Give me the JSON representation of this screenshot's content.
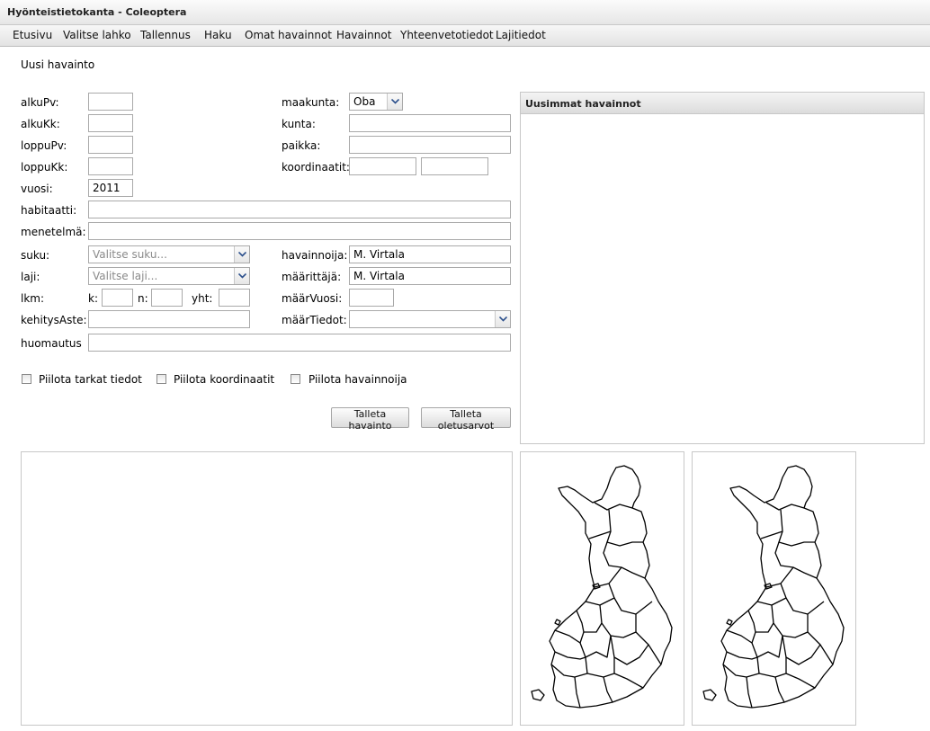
{
  "window": {
    "title": "Hyönteistietokanta - Coleoptera"
  },
  "menu": [
    {
      "label": "Etusivu"
    },
    {
      "label": "Valitse lahko"
    },
    {
      "label": "Tallennus"
    },
    {
      "label": "Haku"
    },
    {
      "label": "Omat havainnot"
    },
    {
      "label": "Havainnot"
    },
    {
      "label": "Yhteenvetotiedot"
    },
    {
      "label": "Lajitiedot"
    }
  ],
  "page": {
    "heading": "Uusi havainto"
  },
  "form": {
    "alkuPv": {
      "label": "alkuPv:",
      "value": ""
    },
    "alkuKk": {
      "label": "alkuKk:",
      "value": ""
    },
    "loppuPv": {
      "label": "loppuPv:",
      "value": ""
    },
    "loppuKk": {
      "label": "loppuKk:",
      "value": ""
    },
    "vuosi": {
      "label": "vuosi:",
      "value": "2011"
    },
    "habitaatti": {
      "label": "habitaatti:",
      "value": ""
    },
    "menetelma": {
      "label": "menetelmä:",
      "value": ""
    },
    "suku": {
      "label": "suku:",
      "placeholder": "Valitse suku..."
    },
    "laji": {
      "label": "laji:",
      "placeholder": "Valitse laji..."
    },
    "lkm": {
      "label": "lkm:",
      "k_label": "k:",
      "n_label": "n:",
      "yht_label": "yht:",
      "k": "",
      "n": "",
      "yht": ""
    },
    "kehitysAste": {
      "label": "kehitysAste:",
      "value": ""
    },
    "huomautus": {
      "label": "huomautus",
      "value": ""
    },
    "maakunta": {
      "label": "maakunta:",
      "value": "Oba"
    },
    "kunta": {
      "label": "kunta:",
      "value": ""
    },
    "paikka": {
      "label": "paikka:",
      "value": ""
    },
    "koordinaatit": {
      "label": "koordinaatit:",
      "value1": "",
      "value2": ""
    },
    "havainnoija": {
      "label": "havainnoija:",
      "value": "M. Virtala"
    },
    "maarittaja": {
      "label": "määrittäjä:",
      "value": "M. Virtala"
    },
    "maarVuosi": {
      "label": "määrVuosi:",
      "value": ""
    },
    "maarTiedot": {
      "label": "määrTiedot:",
      "value": ""
    }
  },
  "checkboxes": {
    "piilota_tarkat": {
      "label": "Piilota tarkat tiedot",
      "checked": false
    },
    "piilota_koordinaatit": {
      "label": "Piilota koordinaatit",
      "checked": false
    },
    "piilota_havainnoija": {
      "label": "Piilota havainnoija",
      "checked": false
    }
  },
  "buttons": {
    "save": "Talleta havainto",
    "save_defaults": "Talleta oletusarvot"
  },
  "latest": {
    "title": "Uusimmat havainnot"
  },
  "maps": [
    {
      "icon": "finland-map-icon"
    },
    {
      "icon": "finland-map-icon"
    }
  ]
}
